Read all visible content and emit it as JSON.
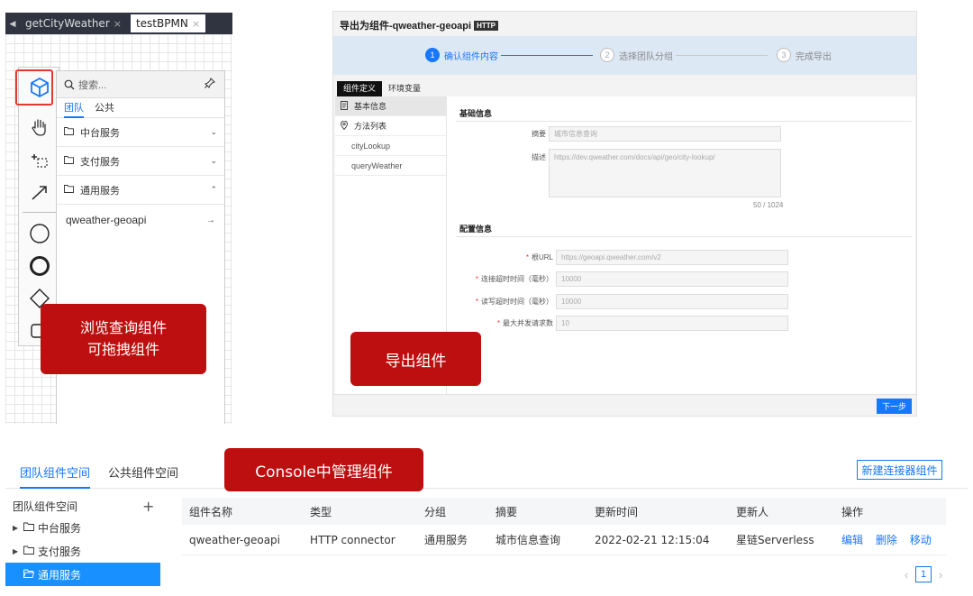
{
  "bpmn": {
    "tabs": [
      {
        "label": "getCityWeather",
        "close": "×"
      },
      {
        "label": "testBPMN",
        "close": "×"
      }
    ],
    "search_placeholder": "搜索...",
    "flyout_tabs": [
      "团队",
      "公共"
    ],
    "groups": [
      {
        "label": "中台服务",
        "chevron": "⌄"
      },
      {
        "label": "支付服务",
        "chevron": "⌄"
      },
      {
        "label": "通用服务",
        "chevron": "⌃"
      }
    ],
    "component": {
      "label": "qweather-geoapi",
      "drag": "→"
    }
  },
  "callouts": {
    "browse_line1": "浏览查询组件",
    "browse_line2": "可拖拽组件",
    "export": "导出组件",
    "console": "Console中管理组件"
  },
  "export": {
    "title": "导出为组件-qweather-geoapi",
    "badge": "HTTP",
    "steps": [
      {
        "num": "1",
        "label": "确认组件内容"
      },
      {
        "num": "2",
        "label": "选择团队分组"
      },
      {
        "num": "3",
        "label": "完成导出"
      }
    ],
    "tabs": [
      "组件定义",
      "环境变量"
    ],
    "nav": {
      "basic": "基本信息",
      "methods": "方法列表",
      "method_items": [
        "cityLookup",
        "queryWeather"
      ]
    },
    "basic_section": "基础信息",
    "summary_label": "摘要",
    "summary_value": "城市信息查询",
    "desc_label": "描述",
    "desc_value": "https://dev.qweather.com/docs/api/geo/city-lookup/",
    "desc_counter": "50 / 1024",
    "config_section": "配置信息",
    "config_fields": [
      {
        "label": "根URL",
        "value": "https://geoapi.qweather.com/v2"
      },
      {
        "label": "连接超时时间（毫秒）",
        "value": "10000"
      },
      {
        "label": "读写超时时间（毫秒）",
        "value": "10000"
      },
      {
        "label": "最大并发请求数",
        "value": "10"
      }
    ],
    "required_mark": "*",
    "next_button": "下一步"
  },
  "console": {
    "tabs": [
      "团队组件空间",
      "公共组件空间"
    ],
    "new_button": "新建连接器组件",
    "tree_title": "团队组件空间",
    "tree_add": "+",
    "tree_items": [
      "中台服务",
      "支付服务",
      "通用服务"
    ],
    "columns": [
      "组件名称",
      "类型",
      "分组",
      "摘要",
      "更新时间",
      "更新人",
      "操作"
    ],
    "row": {
      "name": "qweather-geoapi",
      "type": "HTTP connector",
      "group": "通用服务",
      "summary": "城市信息查询",
      "updated": "2022-02-21 12:15:04",
      "updater": "星链Serverless",
      "actions": [
        "编辑",
        "删除",
        "移动"
      ]
    },
    "pager": {
      "prev": "‹",
      "page": "1",
      "next": "›"
    }
  },
  "colors": {
    "accent": "#1677ff",
    "callout": "#bd0f0f",
    "highlight_border": "#e03a2f",
    "editor_tabbar": "#2f3440"
  },
  "icons": [
    "cube-icon",
    "hand-icon",
    "lasso-icon",
    "connect-arrow-icon",
    "start-event-icon",
    "end-event-icon",
    "gateway-icon",
    "task-icon",
    "search-icon",
    "pin-icon",
    "folder-icon",
    "document-icon",
    "location-icon"
  ]
}
